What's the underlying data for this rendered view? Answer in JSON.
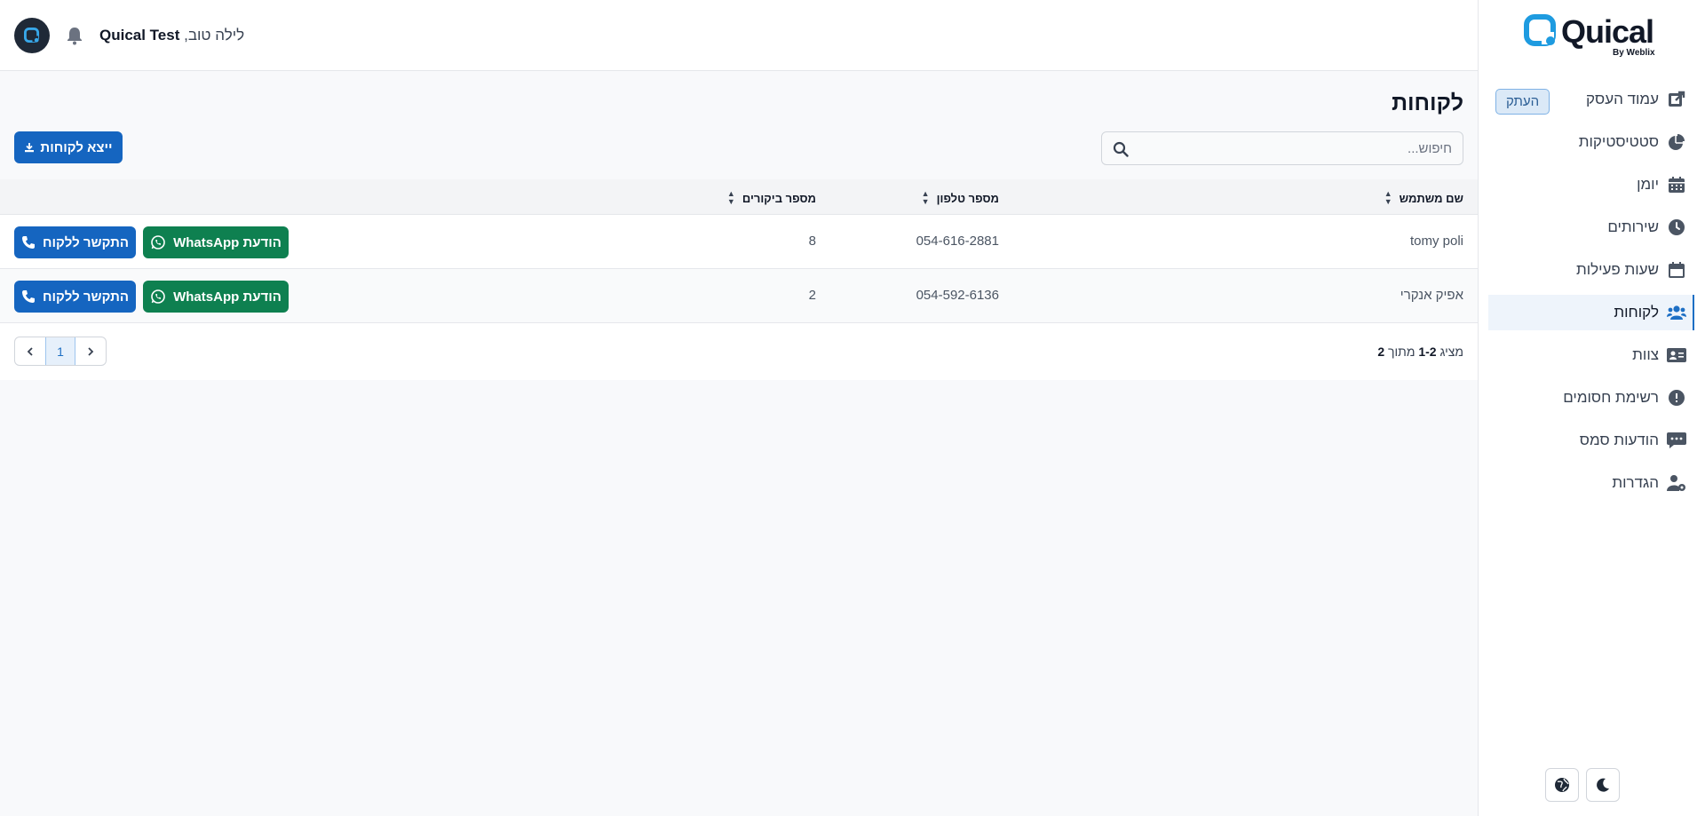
{
  "brand": {
    "name": "Quical",
    "sub": "By Weblix"
  },
  "header": {
    "greeting": "לילה טוב,",
    "user_name": "Quical Test"
  },
  "sidebar": {
    "copy_label": "העתק",
    "items": [
      {
        "label": "עמוד העסק",
        "icon": "external-link-icon"
      },
      {
        "label": "סטטיסטיקות",
        "icon": "pie-chart-icon"
      },
      {
        "label": "יומן",
        "icon": "calendar-icon"
      },
      {
        "label": "שירותים",
        "icon": "clock-icon"
      },
      {
        "label": "שעות פעילות",
        "icon": "calendar-days-icon"
      },
      {
        "label": "לקוחות",
        "icon": "users-icon",
        "active": true
      },
      {
        "label": "צוות",
        "icon": "id-card-icon"
      },
      {
        "label": "רשימת חסומים",
        "icon": "alert-icon"
      },
      {
        "label": "הודעות סמס",
        "icon": "message-icon"
      },
      {
        "label": "הגדרות",
        "icon": "user-gear-icon"
      }
    ]
  },
  "main": {
    "title": "לקוחות",
    "export_label": "ייצא לקוחות",
    "search_placeholder": "חיפוש...",
    "columns": [
      "שם משתמש",
      "מספר טלפון",
      "מספר ביקורים"
    ],
    "rows": [
      {
        "name": "tomy poli",
        "phone": "054-616-2881",
        "visits": "8"
      },
      {
        "name": "אפיק אנקרי",
        "phone": "054-592-6136",
        "visits": "2"
      }
    ],
    "whatsapp_label": "הודעת WhatsApp",
    "call_label": "התקשר ללקוח",
    "pagination": {
      "prefix": "מציג",
      "range": "1-2",
      "of": "מתוך",
      "total": "2",
      "current_page": "1"
    }
  },
  "colors": {
    "primary": "#1565c0",
    "whatsapp": "#0e8050",
    "accent": "#1d6fc4"
  }
}
